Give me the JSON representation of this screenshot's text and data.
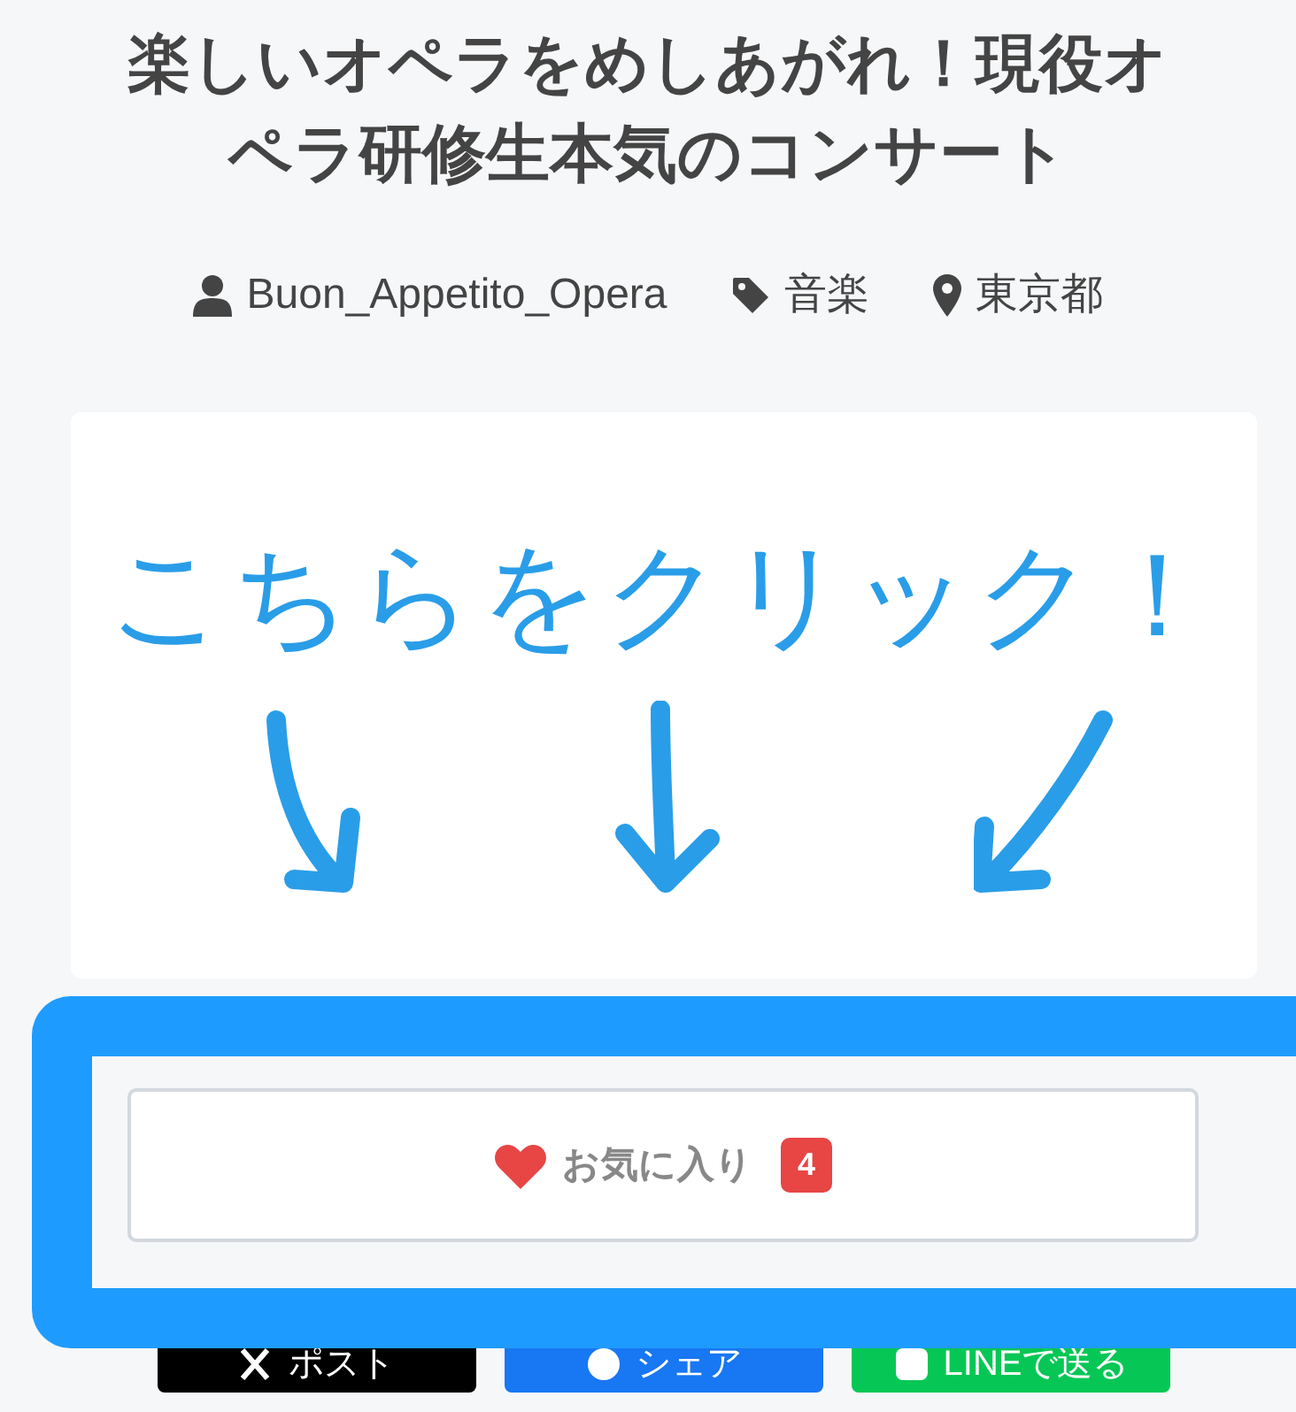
{
  "title": "楽しいオペラをめしあがれ！現役オペラ研修生本気のコンサート",
  "meta": [
    {
      "kind": "user",
      "text": "Buon_Appetito_Opera"
    },
    {
      "kind": "tag",
      "text": "音楽"
    },
    {
      "kind": "place",
      "text": "東京都"
    }
  ],
  "promo": {
    "text": "こちらをクリック！"
  },
  "favorite": {
    "label": "お気に入り",
    "count": "4"
  },
  "share_buttons": [
    {
      "kind": "x",
      "label": "ポスト"
    },
    {
      "kind": "facebook",
      "label": "シェア"
    },
    {
      "kind": "line",
      "label": "LINEで送る"
    }
  ]
}
